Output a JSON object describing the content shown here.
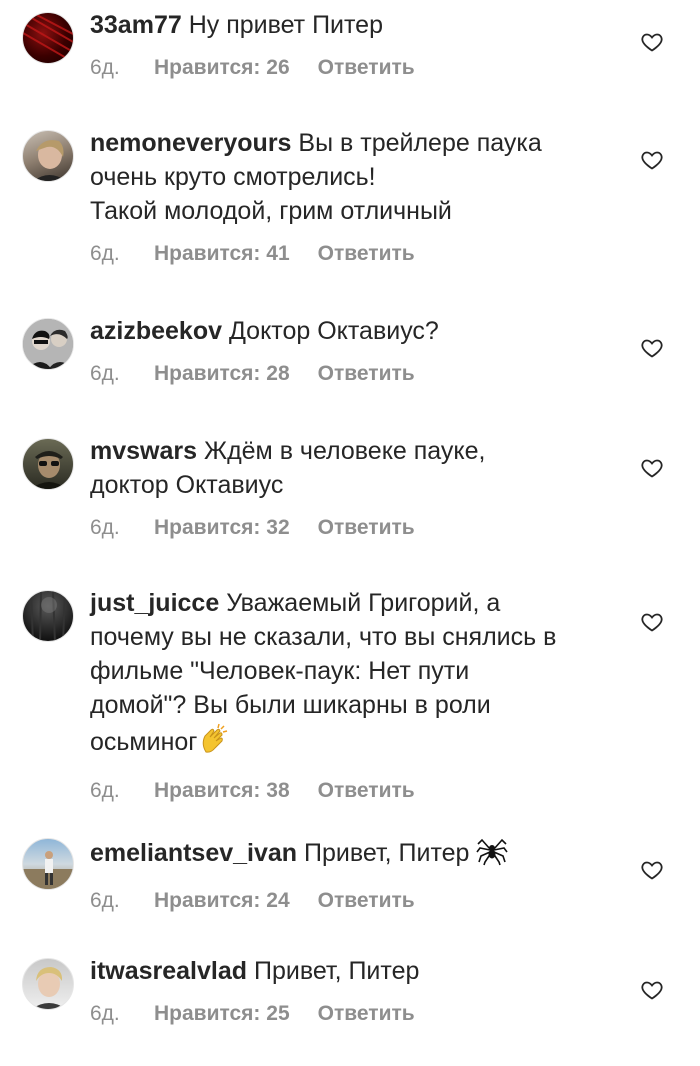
{
  "comments": [
    {
      "user": "33am77",
      "text": "Ну привет Питер",
      "time": "6д.",
      "likes": "Нравится: 26",
      "reply": "Ответить"
    },
    {
      "user": "nemoneveryours",
      "text": "Вы в трейлере паука\nочень круто смотрелись!\nТакой молодой, грим отличный",
      "time": "6д.",
      "likes": "Нравится: 41",
      "reply": "Ответить"
    },
    {
      "user": "azizbeekov",
      "text": "Доктор Октавиус?",
      "time": "6д.",
      "likes": "Нравится: 28",
      "reply": "Ответить"
    },
    {
      "user": "mvswars",
      "text": "Ждём в человеке пауке,\nдоктор Октавиус",
      "time": "6д.",
      "likes": "Нравится: 32",
      "reply": "Ответить"
    },
    {
      "user": "just_juicce",
      "text": "Уважаемый Григорий, а\nпочему вы не сказали, что вы снялись в\nфильме \"Человек-паук: Нет пути\nдомой\"? Вы были шикарны в роли\nосьминог",
      "time": "6д.",
      "likes": "Нравится: 38",
      "reply": "Ответить"
    },
    {
      "user": "emeliantsev_ivan",
      "text": "Привет, Питер",
      "time": "6д.",
      "likes": "Нравится: 24",
      "reply": "Ответить"
    },
    {
      "user": "itwasrealvlad",
      "text": "Привет, Питер",
      "time": "6д.",
      "likes": "Нравится: 25",
      "reply": "Ответить"
    }
  ],
  "icons": {
    "like": "heart-outline-icon",
    "clap": "clapping-hands-emoji",
    "spider": "spider-emoji"
  }
}
